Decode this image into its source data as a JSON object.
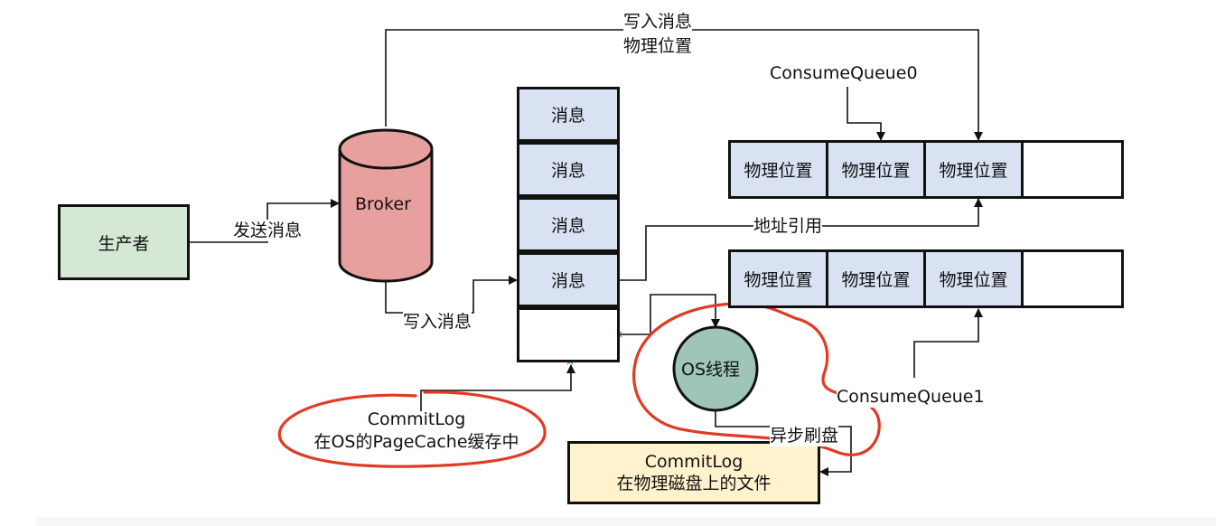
{
  "producer": {
    "label": "生产者"
  },
  "broker": {
    "label": "Broker"
  },
  "edges": {
    "send_message": "发送消息",
    "write_message_top": "写入消息",
    "physical_position_top": "物理位置",
    "write_message_bottom": "写入消息",
    "address_reference": "地址引用",
    "async_flush": "异步刷盘"
  },
  "commitlog_stack": {
    "cells": [
      "消息",
      "消息",
      "消息",
      "消息",
      ""
    ]
  },
  "consume_queue_0": {
    "label": "ConsumeQueue0",
    "cells": [
      "物理位置",
      "物理位置",
      "物理位置",
      ""
    ]
  },
  "consume_queue_1": {
    "label": "ConsumeQueue1",
    "cells": [
      "物理位置",
      "物理位置",
      "物理位置",
      ""
    ]
  },
  "os_thread": {
    "label": "OS线程"
  },
  "pagecache_note": {
    "line1": "CommitLog",
    "line2": "在OS的PageCache缓存中"
  },
  "disk_file": {
    "line1": "CommitLog",
    "line2": "在物理磁盘上的文件"
  },
  "colors": {
    "producer_fill": "#d5e8d4",
    "broker_fill": "#e8a09e",
    "cell_fill": "#d9e2f3",
    "os_thread_fill": "#9fc5b8",
    "disk_fill": "#fff2cc",
    "highlight": "#e03b24",
    "handle": "#3a8ee6"
  }
}
